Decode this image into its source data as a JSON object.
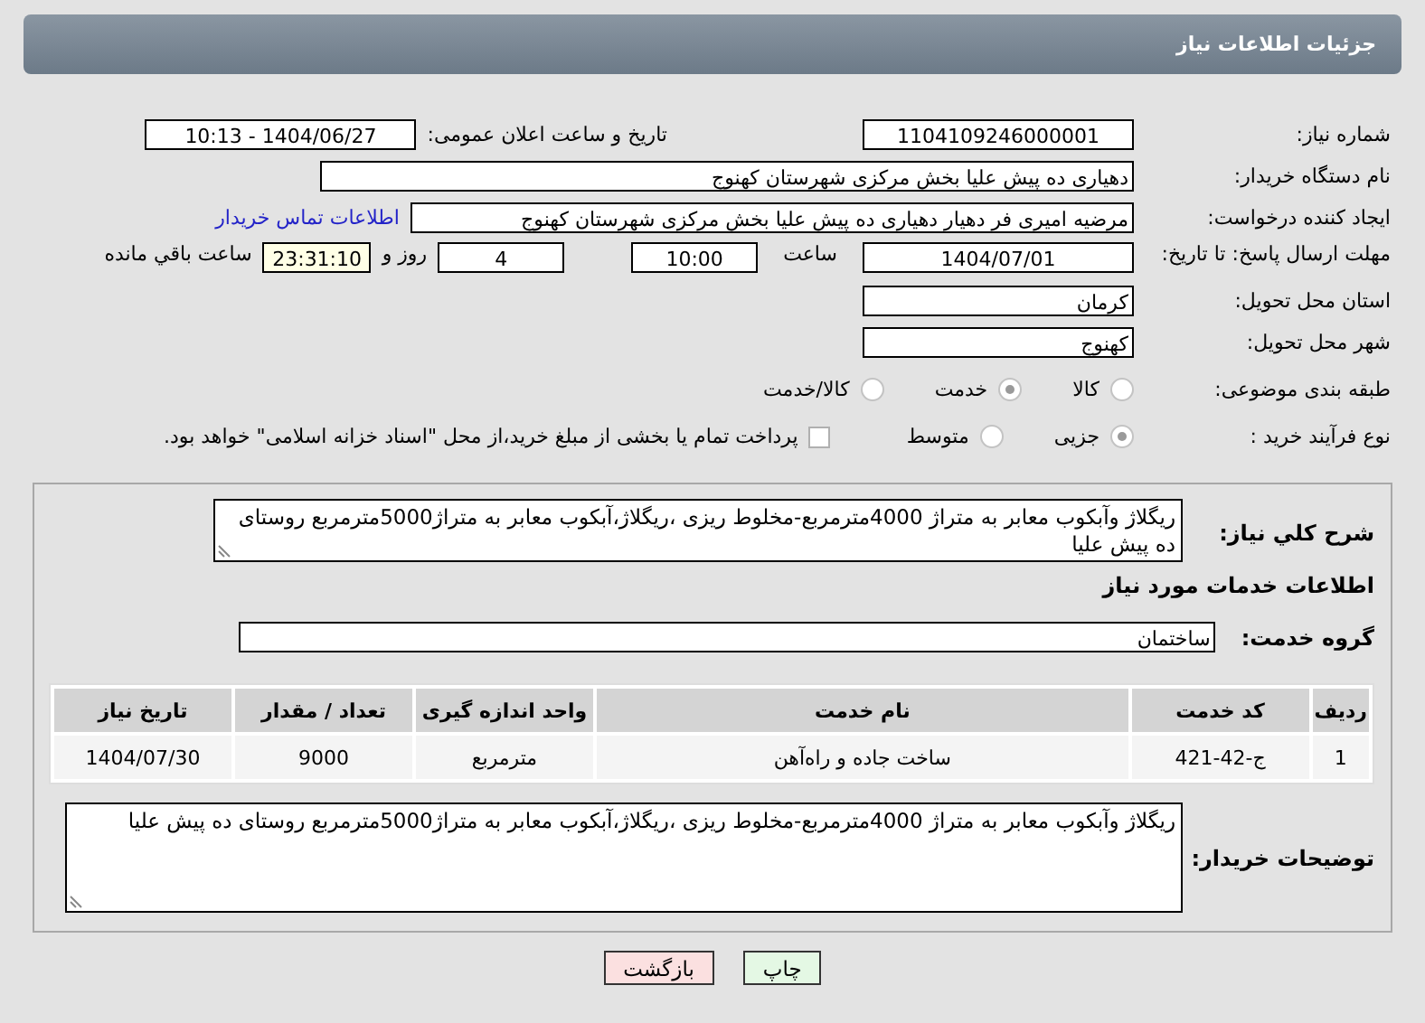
{
  "header": {
    "title": "جزئیات اطلاعات نیاز"
  },
  "need_number": {
    "label": "شماره نیاز:",
    "value": "1104109246000001"
  },
  "announce": {
    "label": "تاریخ و ساعت اعلان عمومی:",
    "value": "1404/06/27 - 10:13"
  },
  "buyer_org": {
    "label": "نام دستگاه خریدار:",
    "value": "دهیاری ده پیش علیا بخش مرکزی شهرستان کهنوج"
  },
  "requester": {
    "label": "ایجاد کننده درخواست:",
    "value": "مرضیه امیری فر دهیار دهیاری ده پیش علیا بخش مرکزی شهرستان کهنوج",
    "link": "اطلاعات تماس خریدار"
  },
  "deadline": {
    "label": "مهلت ارسال پاسخ: تا تاریخ:",
    "date": "1404/07/01",
    "time_label": "ساعت",
    "time": "10:00",
    "days": "4",
    "days_label": "روز و",
    "remaining": "23:31:10",
    "remaining_label": "ساعت باقي مانده"
  },
  "province": {
    "label": "استان محل تحویل:",
    "value": "کرمان"
  },
  "city": {
    "label": "شهر محل تحویل:",
    "value": "کهنوج"
  },
  "category": {
    "label": "طبقه بندی موضوعی:",
    "options": [
      {
        "label": "کالا",
        "selected": false
      },
      {
        "label": "خدمت",
        "selected": true
      },
      {
        "label": "کالا/خدمت",
        "selected": false
      }
    ]
  },
  "process": {
    "label": "نوع فرآیند خرید :",
    "options": [
      {
        "label": "جزیی",
        "selected": true
      },
      {
        "label": "متوسط",
        "selected": false
      }
    ],
    "payment_checked": false,
    "payment_note": "پرداخت تمام یا بخشی از مبلغ خرید،از محل \"اسناد خزانه اسلامی\" خواهد بود."
  },
  "description": {
    "label": "شرح کلي نياز:",
    "value": "ریگلاژ وآبکوب معابر به متراژ 4000مترمربع-مخلوط ریزی ،ریگلاژ،آبکوب معابر به متراژ5000مترمربع روستای ده پیش علیا"
  },
  "services_title": "اطلاعات خدمات مورد نياز",
  "service_group": {
    "label": "گروه خدمت:",
    "value": "ساختمان"
  },
  "table": {
    "columns": [
      "رديف",
      "کد خدمت",
      "نام خدمت",
      "واحد اندازه گیری",
      "تعداد / مقدار",
      "تاریخ نیاز"
    ],
    "rows": [
      [
        "1",
        "ج-42-421",
        "ساخت جاده و راه‌آهن",
        "مترمربع",
        "9000",
        "1404/07/30"
      ]
    ]
  },
  "buyer_notes": {
    "label": "توضیحات خریدار:",
    "value": "ریگلاژ وآبکوب معابر به متراژ 4000مترمربع-مخلوط ریزی ،ریگلاژ،آبکوب معابر به متراژ5000مترمربع روستای ده پیش علیا"
  },
  "buttons": [
    {
      "label": "چاپ",
      "kind": "print"
    },
    {
      "label": "بازگشت",
      "kind": "back"
    }
  ]
}
